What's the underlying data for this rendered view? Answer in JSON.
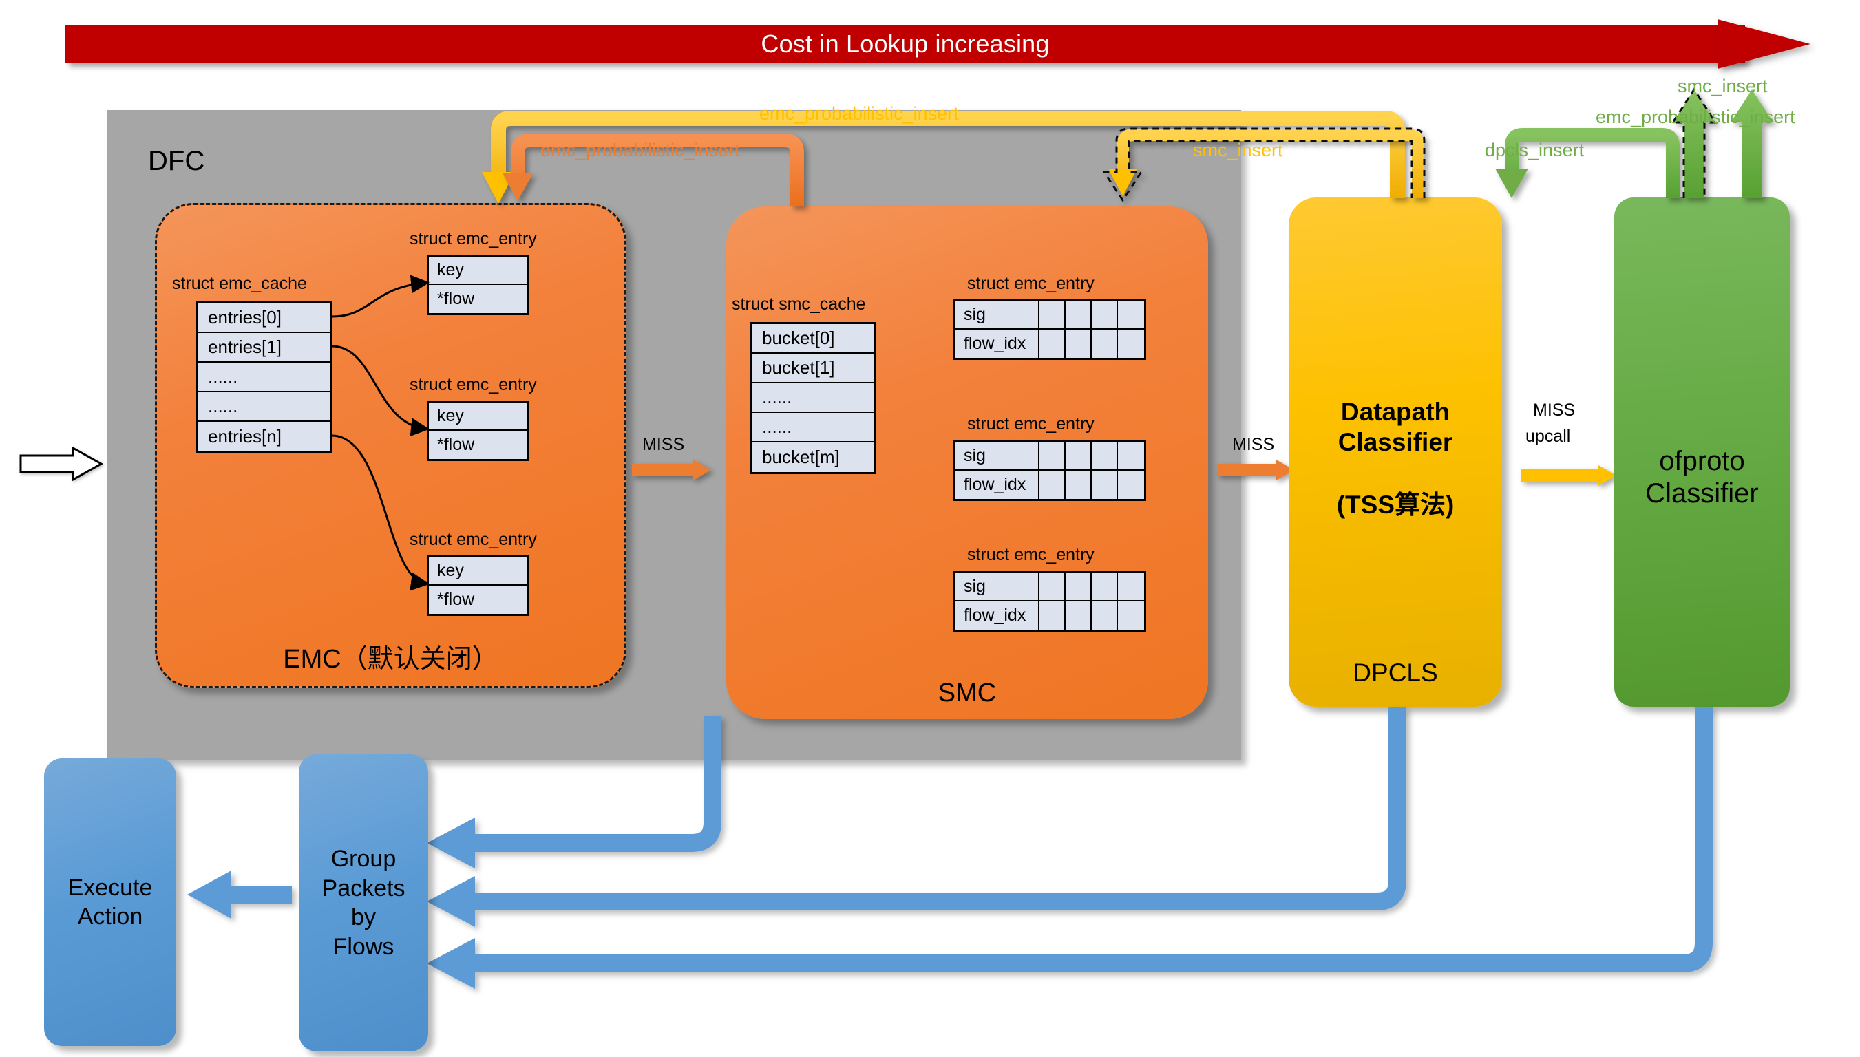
{
  "banner": {
    "text": "Cost in Lookup increasing",
    "color": "#c00000"
  },
  "dfc": {
    "label": "DFC",
    "color": "#a6a6a6"
  },
  "emc": {
    "caption": "EMC（默认关闭）",
    "struct_title": "struct emc_cache",
    "entries": [
      "entries[0]",
      "entries[1]",
      "......",
      "......",
      "entries[n]"
    ],
    "entry_struct_title": "struct emc_entry",
    "entry_fields": [
      "key",
      "*flow"
    ],
    "color": "#ef7522"
  },
  "smc": {
    "caption": "SMC",
    "struct_title": "struct smc_cache",
    "buckets": [
      "bucket[0]",
      "bucket[1]",
      "......",
      "......",
      "bucket[m]"
    ],
    "entry_struct_title": "struct emc_entry",
    "entry_fields": [
      "sig",
      "flow_idx"
    ],
    "color": "#ef7522"
  },
  "dpcls": {
    "title_line1": "Datapath",
    "title_line2": "Classifier",
    "subtitle": "(TSS算法)",
    "footer": "DPCLS",
    "color": "#ffc000"
  },
  "ofproto": {
    "title_line1": "ofproto",
    "title_line2": "Classifier",
    "color": "#70ad47"
  },
  "arrows": {
    "miss_emc_to_smc": "MISS",
    "miss_smc_to_dpcls": "MISS",
    "miss_upcall_line1": "MISS",
    "miss_upcall_line2": "upcall",
    "emc_probabilistic_insert_yellow": "emc_probabilistic_insert",
    "emc_probabilistic_insert_orange": "emc_probabilistic_insert",
    "smc_insert_yellow": "smc_insert",
    "dpcls_insert_green": "dpcls_insert",
    "smc_insert_green": "smc_insert",
    "emc_probabilistic_insert_green": "emc_probabilistic_insert"
  },
  "bottom": {
    "execute_action": "Execute\nAction",
    "group_packets": "Group\nPackets\nby\nFlows"
  },
  "colors": {
    "yellow": "#ffc000",
    "orange": "#ed7d31",
    "green": "#70ad47",
    "blue": "#5b9bd5",
    "red": "#c00000",
    "gray": "#a6a6a6"
  }
}
